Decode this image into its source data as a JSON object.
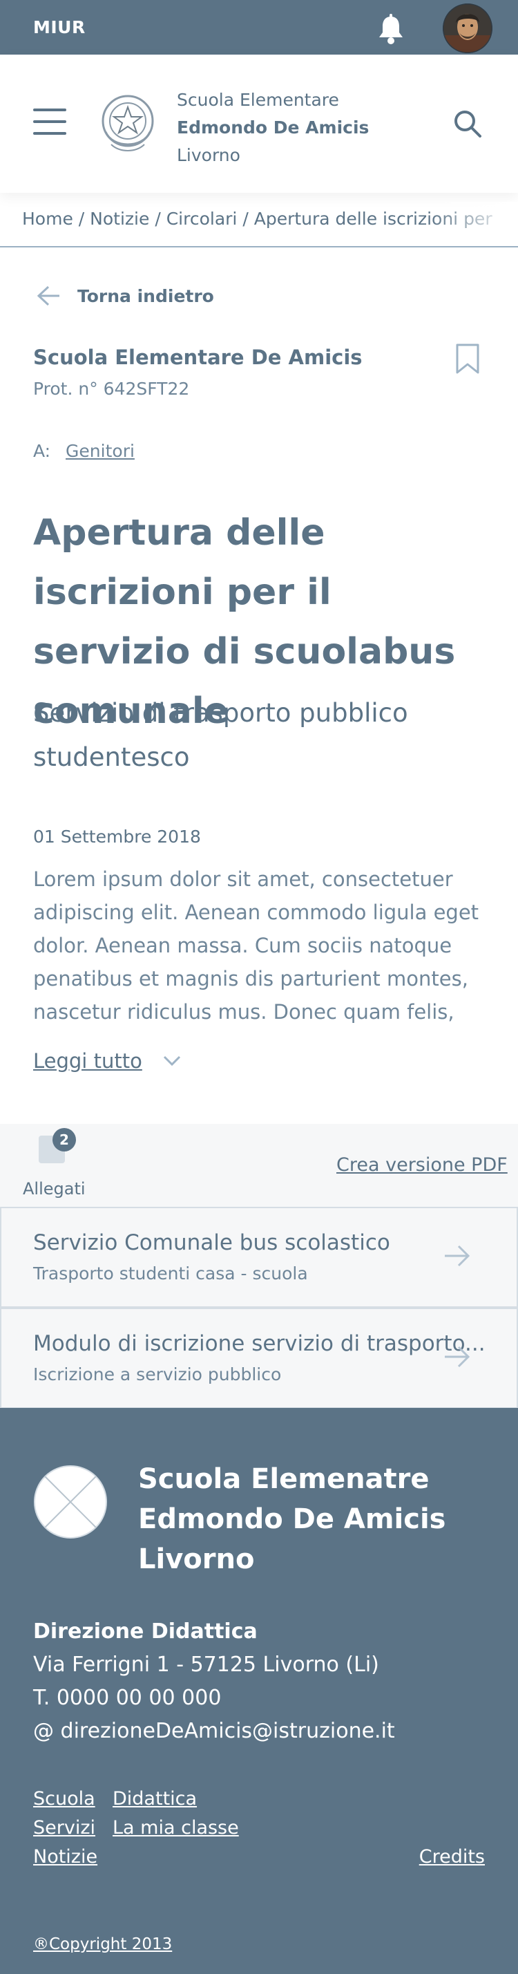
{
  "topbar": {
    "brand": "MIUR",
    "bell_icon": "bell-icon",
    "avatar": "user-avatar"
  },
  "header": {
    "menu_icon": "hamburger-icon",
    "emblem": "republic-emblem",
    "school_line1": "Scuola Elementare",
    "school_line2": "Edmondo De Amicis",
    "school_line3": "Livorno",
    "search_icon": "search-icon"
  },
  "breadcrumb": {
    "items": [
      "Home",
      "Notizie",
      "Circolari",
      "Apertura delle iscrizioni per il servizio di scuolabus comunale"
    ],
    "separator": "/"
  },
  "back": {
    "label": "Torna indietro",
    "icon": "arrow-left-icon"
  },
  "document": {
    "sender": "Scuola Elementare De Amicis",
    "protocol": "Prot. n° 642SFT22",
    "recipient_prefix": "A:",
    "recipient": "Genitori",
    "title": "Apertura delle iscrizioni per il servizio di scuolabus comunale",
    "subtitle": "Servizio di trasporto pubblico studentesco",
    "date": "01 Settembre 2018",
    "body": "Lorem ipsum dolor sit amet, consectetuer adipiscing elit. Aenean commodo ligula eget dolor. Aenean massa. Cum sociis natoque penatibus et magnis dis parturient montes, nascetur ridiculus mus. Donec quam felis,",
    "read_more": "Leggi tutto"
  },
  "attachments": {
    "count": "2",
    "label": "Allegati",
    "pdf_link": "Crea versione PDF",
    "items": [
      {
        "title": "Servizio Comunale bus scolastico",
        "subtitle": "Trasporto studenti casa - scuola"
      },
      {
        "title": "Modulo di iscrizione servizio di trasporto...",
        "subtitle": "Iscrizione a servizio pubblico"
      }
    ]
  },
  "footer": {
    "title_line1": "Scuola Elemenatre",
    "title_line2": "Edmondo De Amicis",
    "title_line3": "Livorno",
    "contacts_head": "Direzione Didattica",
    "address": "Via Ferrigni 1 - 57125 Livorno (Li)",
    "phone": "T. 0000 00 00 000",
    "email": "@ direzioneDeAmicis@istruzione.it",
    "links": [
      "Scuola",
      "Servizi",
      "Notizie",
      "Didattica",
      "La mia classe"
    ],
    "credits": "Credits",
    "copyright": "®Copyright 2013"
  },
  "colors": {
    "primary": "#5b7386",
    "text_secondary": "#6f8699",
    "light_bg": "#f6f7f8",
    "border": "#d5dde4"
  }
}
